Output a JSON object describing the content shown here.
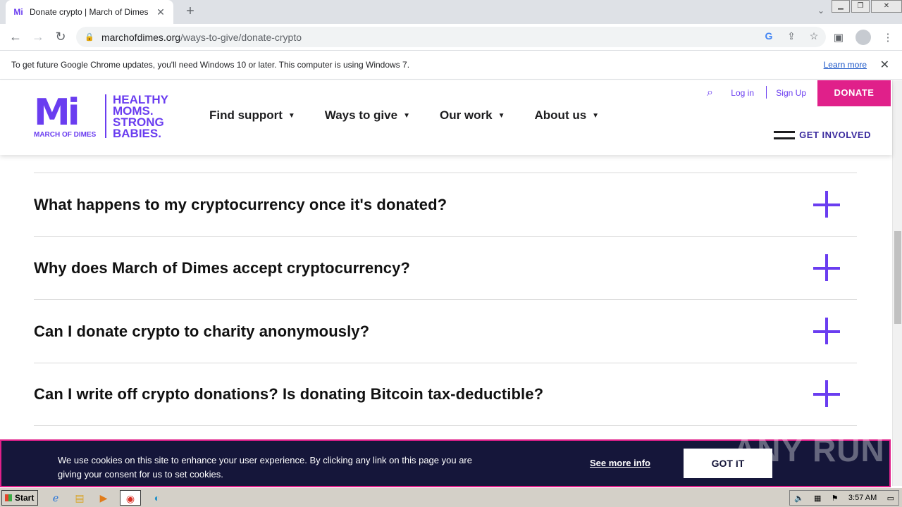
{
  "browser": {
    "tab_title": "Donate crypto | March of Dimes",
    "tab_favicon": "Mi",
    "new_tab_label": "+",
    "url_domain": "marchofdimes.org",
    "url_path": "/ways-to-give/donate-crypto",
    "infobar_text": "To get future Google Chrome updates, you'll need Windows 10 or later. This computer is using Windows 7.",
    "infobar_link": "Learn more"
  },
  "header": {
    "logo_mark": "Mi",
    "logo_org": "MARCH OF DIMES",
    "tagline": [
      "HEALTHY",
      "MOMS.",
      "STRONG",
      "BABIES."
    ],
    "nav": [
      "Find support",
      "Ways to give",
      "Our work",
      "About us"
    ],
    "login": "Log in",
    "signup": "Sign Up",
    "donate": "DONATE",
    "get_involved": "GET INVOLVED"
  },
  "faq": [
    "What happens to my cryptocurrency once it's donated?",
    "Why does March of Dimes accept cryptocurrency?",
    "Can I donate crypto to charity anonymously?",
    "Can I write off crypto donations? Is donating Bitcoin tax-deductible?"
  ],
  "cookie": {
    "message": "We use cookies on this site to enhance your user experience. By clicking any link on this page you are giving your consent for us to set cookies.",
    "more_info": "See more info",
    "button": "GOT IT"
  },
  "watermark": "ANY RUN",
  "taskbar": {
    "start": "Start",
    "clock": "3:57 AM"
  },
  "colors": {
    "brand_purple": "#6a3df0",
    "brand_pink": "#e0208a",
    "cookie_bg": "#15163a"
  }
}
